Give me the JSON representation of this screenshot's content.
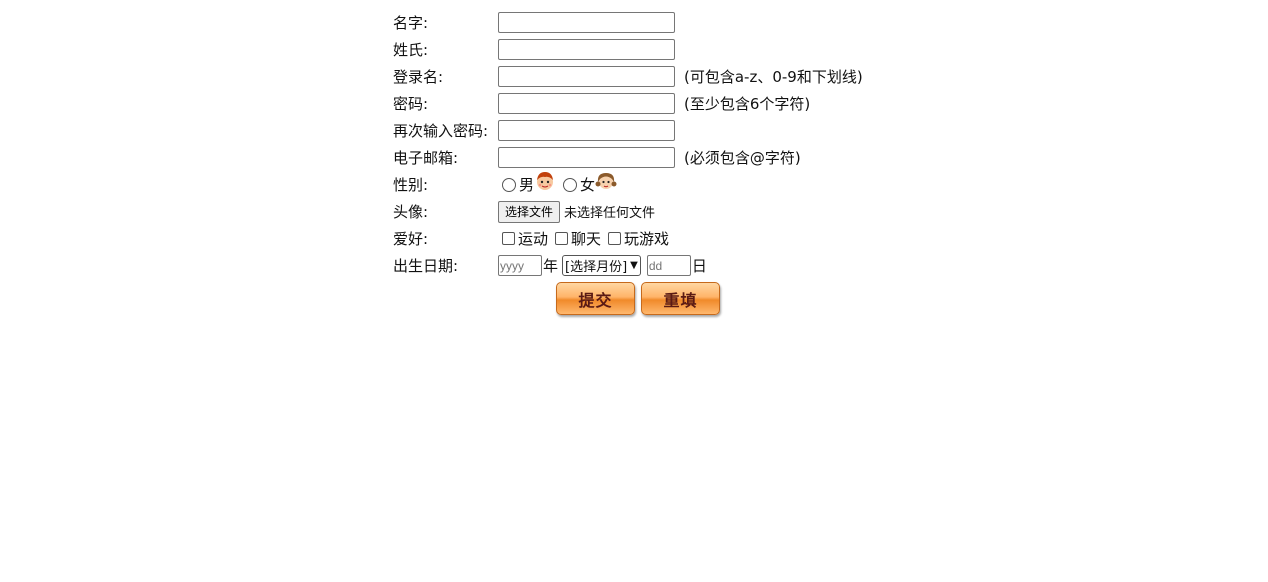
{
  "fields": {
    "first_name": {
      "label": "名字:",
      "value": ""
    },
    "last_name": {
      "label": "姓氏:",
      "value": ""
    },
    "login": {
      "label": "登录名:",
      "value": "",
      "hint": "(可包含a-z、0-9和下划线)"
    },
    "password": {
      "label": "密码:",
      "value": "",
      "hint": "(至少包含6个字符)"
    },
    "password_confirm": {
      "label": "再次输入密码:",
      "value": ""
    },
    "email": {
      "label": "电子邮箱:",
      "value": "",
      "hint": "(必须包含@字符)"
    }
  },
  "gender": {
    "label": "性别:",
    "options": [
      {
        "label": "男",
        "icon": "boy-avatar-icon"
      },
      {
        "label": "女",
        "icon": "girl-avatar-icon"
      }
    ]
  },
  "avatar": {
    "label": "头像:",
    "button_label": "选择文件",
    "status": "未选择任何文件"
  },
  "hobbies": {
    "label": "爱好:",
    "options": [
      "运动",
      "聊天",
      "玩游戏"
    ]
  },
  "birthday": {
    "label": "出生日期:",
    "year_placeholder": "yyyy",
    "year_unit": "年",
    "month_selected": "[选择月份]",
    "day_placeholder": "dd",
    "day_unit": "日"
  },
  "actions": {
    "submit_label": "提交",
    "reset_label": "重填"
  },
  "colors": {
    "button_orange": "#f08a2a",
    "button_text": "#5a1a14"
  }
}
